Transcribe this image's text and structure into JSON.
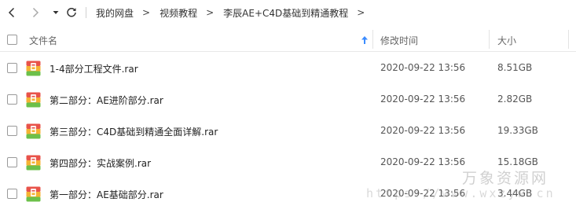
{
  "breadcrumb": {
    "items": [
      "我的网盘",
      "视频教程",
      "李辰AE+C4D基础到精通教程"
    ],
    "separator": ">"
  },
  "columns": {
    "name": "文件名",
    "modified": "修改时间",
    "size": "大小",
    "sort_icon": "arrow-up-icon"
  },
  "files": [
    {
      "name": "1-4部分工程文件.rar",
      "modified": "2020-09-22 13:56",
      "size": "8.51GB",
      "icon": "rar-archive-icon"
    },
    {
      "name": "第二部分：AE进阶部分.rar",
      "modified": "2020-09-22 13:56",
      "size": "2.82GB",
      "icon": "rar-archive-icon"
    },
    {
      "name": "第三部分：C4D基础到精通全面详解.rar",
      "modified": "2020-09-22 13:56",
      "size": "19.33GB",
      "icon": "rar-archive-icon"
    },
    {
      "name": "第四部分：实战案例.rar",
      "modified": "2020-09-22 13:56",
      "size": "15.18GB",
      "icon": "rar-archive-icon"
    },
    {
      "name": "第一部分：AE基础部分.rar",
      "modified": "2020-09-22 13:56",
      "size": "3.44GB",
      "icon": "rar-archive-icon"
    }
  ],
  "watermark": {
    "text": "万象资源网",
    "url": "https://www.wxzyw.cn"
  },
  "colors": {
    "accent": "#3b8cff",
    "archive_top": "#e8534a",
    "archive_mid": "#f5b233",
    "archive_bottom": "#6cc04a"
  }
}
